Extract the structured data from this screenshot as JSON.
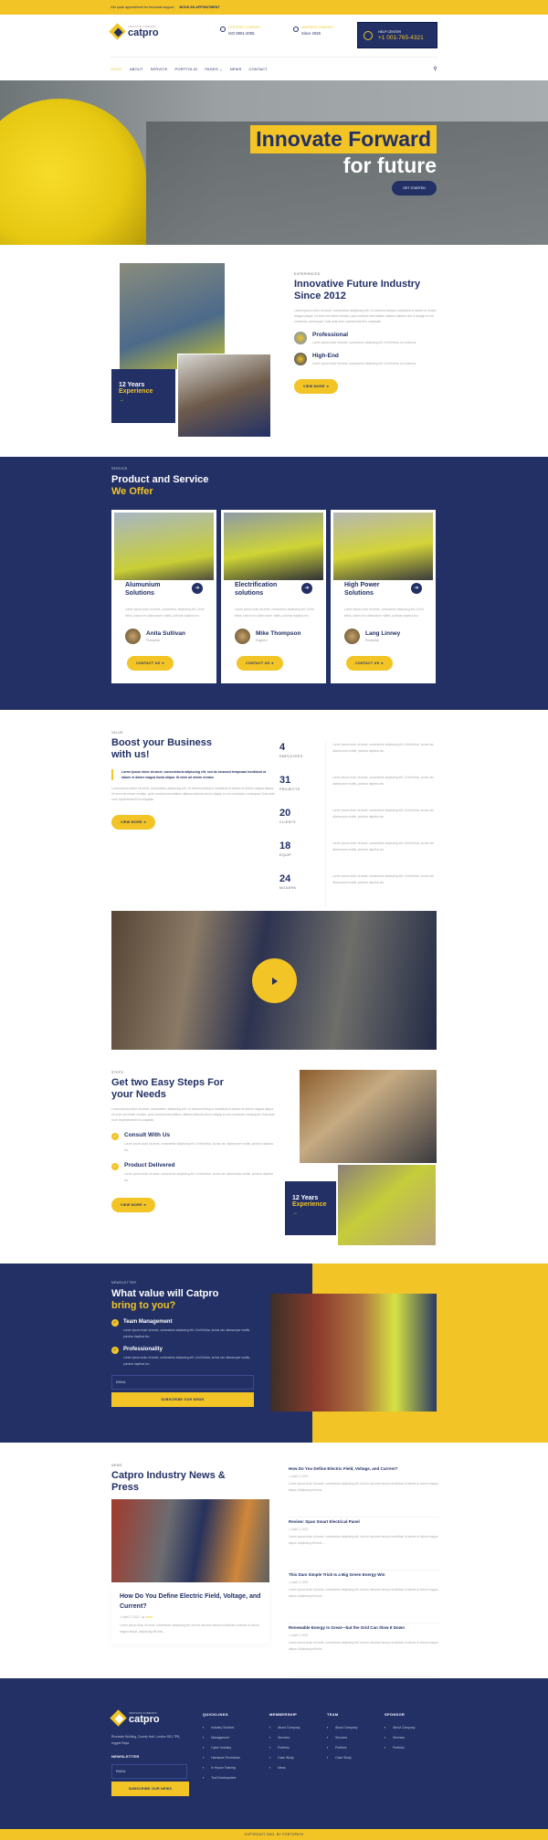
{
  "topbar": {
    "text": "Get quick appointment for technical support",
    "link": "BOOK AN APPOINTMENT"
  },
  "brand": {
    "tagline": "INNOVATE FORWARD",
    "name": "catpro"
  },
  "header": {
    "certs": [
      {
        "icon": "check-circle-icon",
        "label": "CERTIFIED COMPANY",
        "value": "ISO 9001-2005"
      },
      {
        "icon": "check-circle-icon",
        "label": "AWARDED COMPANY",
        "value": "Since 2025"
      }
    ],
    "help": {
      "icon": "headset-icon",
      "label": "HELP CENTER",
      "phone": "+1 001-765-4321"
    }
  },
  "nav": {
    "items": [
      "HOME",
      "ABOUT",
      "SERVICE",
      "PORTFOLIO",
      "PAGES ⌄",
      "NEWS",
      "CONTACT"
    ],
    "active": "HOME",
    "search_icon": "search-icon"
  },
  "hero": {
    "line1": "Innovate Forward",
    "line2": "for future",
    "cta": "GET STARTED"
  },
  "about": {
    "eyebrow": "EXPERIENCED",
    "title": "Innovative Future Industry Since 2012",
    "text": "Lorem ipsum dolor sit amet, consectetur adipiscing elit. Ut eiusmod tempor incididunt ut labore et dolore magna aliqua. Ut enim ad minim veniam, quis nostrud exercitation ullamco laboris nisi ut aliquip ex ea commodo consequat. Duis aute irure reprehenderit in voluptate.",
    "experience": {
      "years": "12 Years",
      "label": "Experience",
      "arrow": "→"
    },
    "features": [
      {
        "icon": "gear-helmet-icon",
        "title": "Professional",
        "text": "Lorem ipsum dolor sit amet, consectetur adipiscing elit. Ut elit tellus no contenus."
      },
      {
        "icon": "robot-arm-icon",
        "title": "High-End",
        "text": "Lorem ipsum dolor sit amet, consectetur adipiscing elit. Ut elit tellus no contenus."
      }
    ],
    "cta": "VIEW MORE ➔"
  },
  "services": {
    "eyebrow": "SERVICE",
    "title_a": "Product and Service",
    "title_b": "We Offer",
    "cards": [
      {
        "title": "Alumunium Solutions",
        "text": "Lorem ipsum dolor sit amet, consectetur adipiscing elit. Ut elit tellus, luctus nec ullamcorper mattis, pulvinar dapibus leo.",
        "person": "Anita Sullivan",
        "role": "Production",
        "cta": "CONTACT US ➔"
      },
      {
        "title": "Electrification solutions",
        "text": "Lorem ipsum dolor sit amet, consectetur adipiscing elit. Ut elit tellus, luctus nec ullamcorper mattis, pulvinar dapibus leo.",
        "person": "Mike Thompson",
        "role": "Engineer",
        "cta": "CONTACT US ➔"
      },
      {
        "title": "High Power Solutions",
        "text": "Lorem ipsum dolor sit amet, consectetur adipiscing elit. Ut elit tellus, luctus nec ullamcorper mattis, pulvinar dapibus leo.",
        "person": "Lang Linney",
        "role": "Production",
        "cta": "CONTACT US ➔"
      }
    ]
  },
  "value": {
    "eyebrow": "VALUE",
    "title": "Boost your Business with us!",
    "quote": "Lorem ipsum dolor sit amet, consecteturia adipiscing elit, sed do eiusmod temporaal incididunt ut labore et dolore magna lional aliqua. Ut enim ad minim veniam.",
    "text": "Lorem ipsum dolor sit amet, consectetur adipiscing elit. Ut eiusmod tempor incididunt ut labore et dolore magna aliqua. Ut enim ad minim veniam, quis nostrud exercitation ullamco laboris nisi ut aliquip ex ea commodo consequat. Duis aute irure reprehenderit in voluptate.",
    "cta": "VIEW MORE ➔",
    "stats": [
      {
        "num": "4",
        "label": "EMPLOYEES",
        "text": "Lorem ipsum dolor sit amet, consectetur adipiscing elit. Ut elit tellus, luctus nec ullamcorper mattis, pulvinar dapibus leo."
      },
      {
        "num": "31",
        "label": "PROJECTS",
        "text": "Lorem ipsum dolor sit amet, consectetur adipiscing elit. Ut elit tellus, luctus nec ullamcorper mattis, pulvinar dapibus leo."
      },
      {
        "num": "20",
        "label": "CLIENTS",
        "text": "Lorem ipsum dolor sit amet, consectetur adipiscing elit. Ut elit tellus, luctus nec ullamcorper mattis, pulvinar dapibus leo."
      },
      {
        "num": "18",
        "label": "EQUIP",
        "text": "Lorem ipsum dolor sit amet, consectetur adipiscing elit. Ut elit tellus, luctus nec ullamcorper mattis, pulvinar dapibus leo."
      },
      {
        "num": "24",
        "label": "MODERN",
        "text": "Lorem ipsum dolor sit amet, consectetur adipiscing elit. Ut elit tellus, luctus nec ullamcorper mattis, pulvinar dapibus leo."
      }
    ]
  },
  "video": {
    "play_icon": "play-icon"
  },
  "steps": {
    "eyebrow": "STEPS",
    "title": "Get two Easy Steps For your Needs",
    "text": "Lorem ipsum dolor sit amet, consectetur adipiscing elit. Ut eiusmod tempor incididunt ut labore et dolore magna aliqua. Ut enim ad minim veniam, quis nostrud exercitation ullamco laboris nisi ut aliquip ex ea commodo consequat. Duis aute irure reprehenderit in voluptate.",
    "items": [
      {
        "title": "Consult With Us",
        "text": "Lorem ipsum dolor sit amet, consectetur adipiscing elit. Ut elit tellus, luctus nec ullamcorper mattis, pulvinar dapibus leo."
      },
      {
        "title": "Product Delivered",
        "text": "Lorem ipsum dolor sit amet, consectetur adipiscing elit. Ut elit tellus, luctus nec ullamcorper mattis, pulvinar dapibus leo."
      }
    ],
    "cta": "VIEW MORE ➔",
    "experience": {
      "years": "12 Years",
      "label": "Experience",
      "arrow": "→"
    }
  },
  "newsletter": {
    "eyebrow": "NEWSLETTER",
    "title_a": "What value will Catpro",
    "title_b": "bring to you?",
    "items": [
      {
        "title": "Team Management",
        "text": "Lorem ipsum dolor sit amet, consectetur adipiscing elit. Ut elit tellus, luctus nec ullamcorper mattis, pulvinar dapibus leo."
      },
      {
        "title": "Professionality",
        "text": "Lorem ipsum dolor sit amet, consectetur adipiscing elit. Ut elit tellus, luctus nec ullamcorper mattis, pulvinar dapibus leo."
      }
    ],
    "email_placeholder": "EMAIL",
    "subscribe": "SUBSCRIBE OUR NEWS"
  },
  "news": {
    "eyebrow": "NEWS",
    "title": "Catpro Industry News & Press",
    "featured": {
      "title": "How Do You Define Electric Field, Voltage, and Current?",
      "date": "April 3, 2022",
      "tag": "News",
      "text": "Lorem ipsum dolor sit amet, consectetur adipiscing elit, sed do eiusmod tempor incididunt ut labore et dolore magna aliqua. Adipiscing elit duis ..."
    },
    "list": [
      {
        "title": "How Do You Define Electric Field, Voltage, and Current?",
        "date": "April 3, 2022",
        "text": "Lorem ipsum dolor sit amet, consectetur adipiscing elit, sed do eiusmod tempor incididunt ut labore et dolore magna aliqua. Adipiscing elit duis ..."
      },
      {
        "title": "Review: Span Smart Electrical Panel",
        "date": "April 3, 2022",
        "text": "Lorem ipsum dolor sit amet, consectetur adipiscing elit, sed do eiusmod tempor incididunt ut labore et dolore magna aliqua. Adipiscing elit duis ..."
      },
      {
        "title": "This Dam Simple Trick Is a Big Green Energy Win",
        "date": "April 3, 2022",
        "text": "Lorem ipsum dolor sit amet, consectetur adipiscing elit, sed do eiusmod tempor incididunt ut labore et dolore magna aliqua. Adipiscing elit duis ..."
      },
      {
        "title": "Renewable Energy Is Great—but the Grid Can Slow It Down",
        "date": "April 3, 2022",
        "text": "Lorem ipsum dolor sit amet, consectetur adipiscing elit, sed do eiusmod tempor incididunt ut labore et dolore magna aliqua. Adipiscing elit duis ..."
      }
    ]
  },
  "footer": {
    "address": "Riverside Building, County Hall, London SE1 7PB, Inggris Raya",
    "newsletter_label": "NEWSLETTER",
    "email_placeholder": "EMAIL",
    "subscribe": "SUBSCRIBE OUR NEWS",
    "columns": [
      {
        "title": "QUICKLINKS",
        "links": [
          "Industry Solution",
          "Management",
          "Cyber Industry",
          "Hardware Technician",
          "In House Training",
          "Tool Development"
        ]
      },
      {
        "title": "MEMBERSHIP",
        "links": [
          "About Company",
          "Services",
          "Portfolio",
          "Case Study",
          "News"
        ]
      },
      {
        "title": "TEAM",
        "links": [
          "About Company",
          "Services",
          "Portfolio",
          "Case Study"
        ]
      },
      {
        "title": "SPONSOR",
        "links": [
          "About Company",
          "Services",
          "Portfolio"
        ]
      }
    ],
    "copyright": "COPYRIGHT 2023. BY PORTOPATH"
  },
  "colors": {
    "brand_yellow": "#f2c425",
    "brand_navy": "#223066"
  }
}
